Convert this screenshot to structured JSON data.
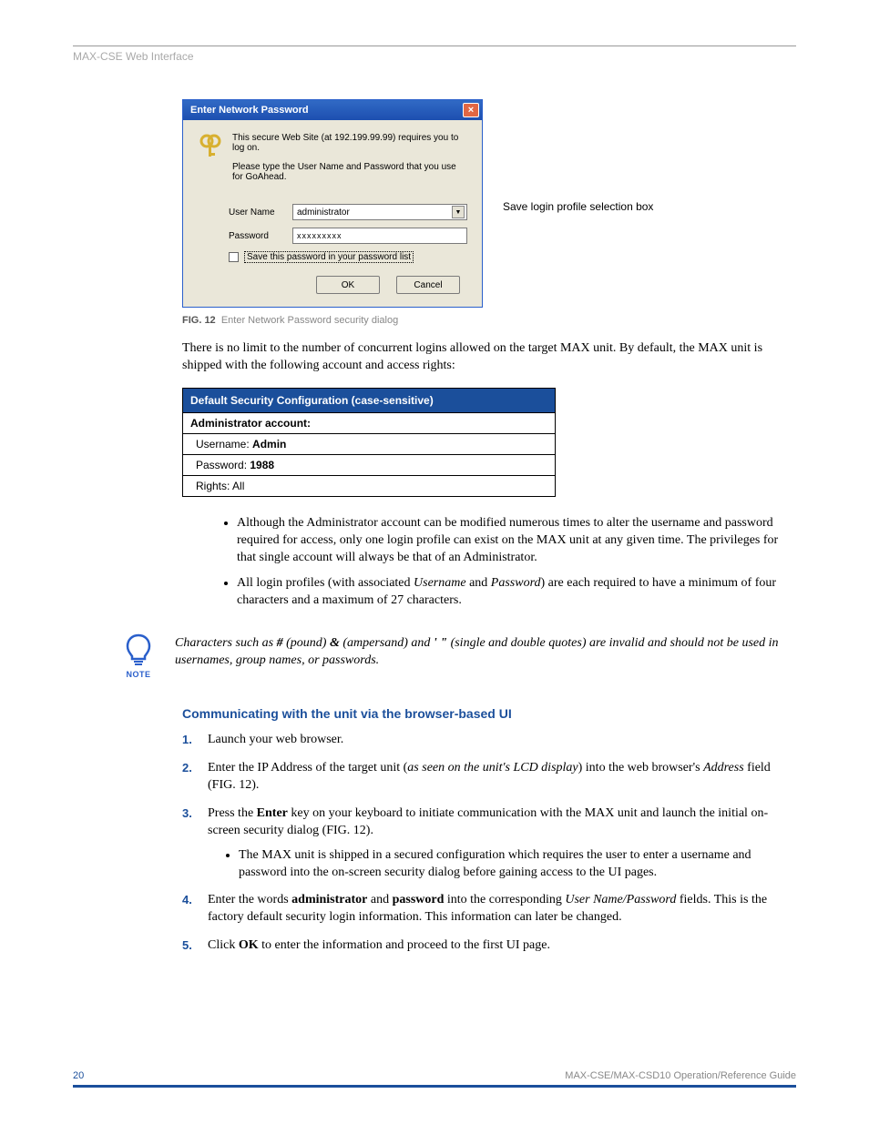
{
  "header": {
    "title": "MAX-CSE Web Interface"
  },
  "dialog": {
    "title": "Enter Network Password",
    "line1": "This secure Web Site (at 192.199.99.99) requires you to log on.",
    "line2": "Please type the User Name and Password that you use for GoAhead.",
    "userLabel": "User Name",
    "userValue": "administrator",
    "passLabel": "Password",
    "passMask": "xxxxxxxxx",
    "saveLabel": "Save this password in your password list",
    "okLabel": "OK",
    "cancelLabel": "Cancel"
  },
  "callout": "Save login profile selection box",
  "fig": {
    "label": "FIG. 12",
    "caption": "Enter Network Password security dialog"
  },
  "p1": "There is no limit to the number of concurrent logins allowed on the target MAX unit. By default, the MAX unit is shipped with the following account and access rights:",
  "table": {
    "header": "Default Security Configuration (case-sensitive)",
    "rows": [
      {
        "html": "<b>Administrator account:</b>",
        "sub": false
      },
      {
        "html": "Username: <b>Admin</b>",
        "sub": true
      },
      {
        "html": "Password: <b>1988</b>",
        "sub": true
      },
      {
        "html": "Rights: All",
        "sub": true
      }
    ]
  },
  "bullets": [
    "Although the Administrator account can be modified numerous times to alter the username and password required for access, only one login profile can exist on the MAX unit at any given time. The privileges for that single account will always be that of an Administrator.",
    "All login profiles (with associated <i>Username</i> and <i>Password</i>) are each required to have a minimum of four characters and a maximum of 27 characters."
  ],
  "note": {
    "label": "NOTE",
    "text": "Characters such as <b>#</b> (pound) <b>&amp;</b> (ampersand) and <b>'  \"</b> (single and double quotes) are invalid and should not be used in usernames, group names, or passwords."
  },
  "section2": "Communicating with the unit via the browser-based UI",
  "steps": [
    "Launch your web browser.",
    "Enter the IP Address of the target unit (<i>as seen on the unit's LCD display</i>) into the web browser's <i>Address</i> field (FIG. 12).",
    "Press the <b>Enter</b> key on your keyboard to initiate communication with the MAX unit and launch the initial on-screen security dialog (FIG. 12).",
    "Enter the words <b>administrator</b> and <b>password</b> into the corresponding <i>User Name/Password</i> fields. This is the factory default security login information. This information can later be changed.",
    "Click <b>OK</b> to enter the information and proceed to the first UI page."
  ],
  "step3sub": "The MAX unit is shipped in a secured configuration which requires the user to enter a username and password into the on-screen security dialog before gaining access to the UI pages.",
  "footer": {
    "page": "20",
    "doc": "MAX-CSE/MAX-CSD10 Operation/Reference Guide"
  }
}
